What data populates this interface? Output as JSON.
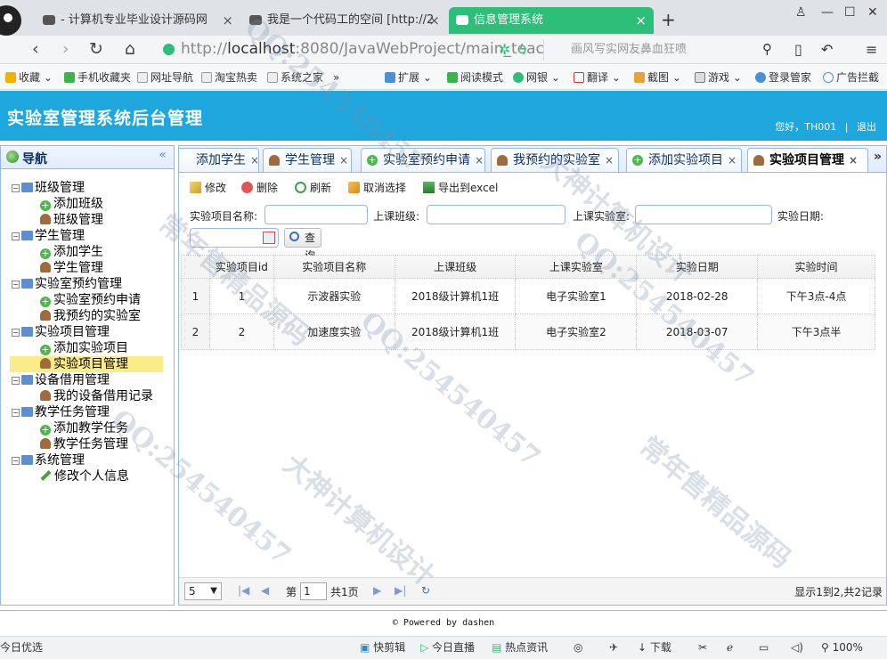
{
  "browser": {
    "tabs": [
      {
        "title": "- 计算机专业毕业设计源码网"
      },
      {
        "title": "我是一个代码工的空间 [http://2"
      },
      {
        "title": "信息管理系统"
      }
    ],
    "url_prefix": "http://",
    "url_host": "localhost",
    "url_rest": ":8080/JavaWebProject/main_teac",
    "search_placeholder": "画风写实网友鼻血狂喷",
    "bookmarks": [
      "收藏",
      "手机收藏夹",
      "网址导航",
      "淘宝热卖",
      "系统之家",
      "»",
      "扩展",
      "阅读模式",
      "网银",
      "翻译",
      "截图",
      "游戏",
      "登录管家",
      "广告拦截"
    ]
  },
  "app": {
    "title": "实验室管理系统后台管理",
    "user_greeting": "您好，TH001",
    "separator": "|",
    "logout": "退出"
  },
  "nav": {
    "title": "导航",
    "collapse": "«",
    "groups": [
      {
        "label": "班级管理",
        "items": [
          "添加班级",
          "班级管理"
        ]
      },
      {
        "label": "学生管理",
        "items": [
          "添加学生",
          "学生管理"
        ]
      },
      {
        "label": "实验室预约管理",
        "items": [
          "实验室预约申请",
          "我预约的实验室"
        ]
      },
      {
        "label": "实验项目管理",
        "items": [
          "添加实验项目",
          "实验项目管理"
        ]
      },
      {
        "label": "设备借用管理",
        "items": [
          "我的设备借用记录"
        ]
      },
      {
        "label": "教学任务管理",
        "items": [
          "添加教学任务",
          "教学任务管理"
        ]
      },
      {
        "label": "系统管理",
        "items": [
          "修改个人信息"
        ]
      }
    ]
  },
  "tabs": [
    "添加学生",
    "学生管理",
    "实验室预约申请",
    "我预约的实验室",
    "添加实验项目",
    "实验项目管理"
  ],
  "toolbar": {
    "edit": "修改",
    "delete": "删除",
    "refresh": "刷新",
    "cancel_select": "取消选择",
    "export": "导出到excel"
  },
  "filter": {
    "name_label": "实验项目名称:",
    "class_label": "上课班级:",
    "room_label": "上课实验室:",
    "date_label": "实验日期:",
    "query": "查询"
  },
  "table": {
    "headers": [
      "实验项目id",
      "实验项目名称",
      "上课班级",
      "上课实验室",
      "实验日期",
      "实验时间"
    ],
    "rows": [
      {
        "rn": "1",
        "id": "1",
        "name": "示波器实验",
        "cls": "2018级计算机1班",
        "room": "电子实验室1",
        "date": "2018-02-28",
        "time": "下午3点-4点"
      },
      {
        "rn": "2",
        "id": "2",
        "name": "加速度实验",
        "cls": "2018级计算机1班",
        "room": "电子实验室2",
        "date": "2018-03-07",
        "time": "下午3点半"
      }
    ]
  },
  "pager": {
    "page_size": "5",
    "page_prefix": "第",
    "page_value": "1",
    "page_total": "共1页",
    "info": "显示1到2,共2记录"
  },
  "footer": "© Powered by dashen",
  "statusbar": [
    "今日优选",
    "快剪辑",
    "今日直播",
    "热点资讯",
    "下载",
    "100%"
  ],
  "watermarks": [
    "QQ:254540457",
    "大神计算机设计",
    "常年售精品源码"
  ],
  "colors": {
    "header": "#1ea7dd",
    "active_tab": "#2dbf7a",
    "selected_node": "#fbec88"
  }
}
